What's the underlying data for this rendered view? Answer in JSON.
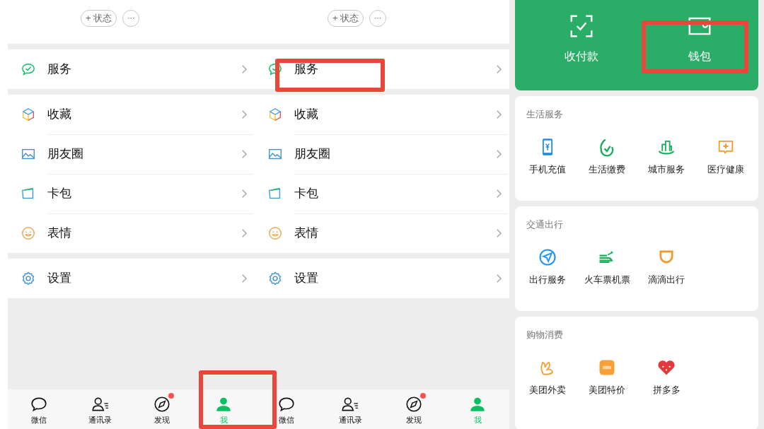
{
  "phones": [
    {
      "status_button": "+ 状态",
      "more_button": "···",
      "groups": [
        [
          {
            "kind": "services",
            "label": "服务"
          }
        ],
        [
          {
            "kind": "favorites",
            "label": "收藏"
          },
          {
            "kind": "moments",
            "label": "朋友圈"
          },
          {
            "kind": "cards",
            "label": "卡包"
          },
          {
            "kind": "stickers",
            "label": "表情"
          }
        ],
        [
          {
            "kind": "settings",
            "label": "设置"
          }
        ]
      ],
      "tabs": [
        {
          "kind": "chats",
          "label": "微信",
          "selected": false,
          "dot": false
        },
        {
          "kind": "contacts",
          "label": "通讯录",
          "selected": false,
          "dot": false
        },
        {
          "kind": "discover",
          "label": "发现",
          "selected": false,
          "dot": true
        },
        {
          "kind": "me",
          "label": "我",
          "selected": true,
          "dot": false
        }
      ]
    },
    {
      "status_button": "+ 状态",
      "more_button": "···",
      "groups": [
        [
          {
            "kind": "services",
            "label": "服务"
          }
        ],
        [
          {
            "kind": "favorites",
            "label": "收藏"
          },
          {
            "kind": "moments",
            "label": "朋友圈"
          },
          {
            "kind": "cards",
            "label": "卡包"
          },
          {
            "kind": "stickers",
            "label": "表情"
          }
        ],
        [
          {
            "kind": "settings",
            "label": "设置"
          }
        ]
      ],
      "tabs": [
        {
          "kind": "chats",
          "label": "微信",
          "selected": false,
          "dot": false
        },
        {
          "kind": "contacts",
          "label": "通讯录",
          "selected": false,
          "dot": false
        },
        {
          "kind": "discover",
          "label": "发现",
          "selected": false,
          "dot": true
        },
        {
          "kind": "me",
          "label": "我",
          "selected": true,
          "dot": false
        }
      ]
    }
  ],
  "services": {
    "pay_actions": [
      {
        "kind": "scan",
        "label": "收付款"
      },
      {
        "kind": "wallet",
        "label": "钱包"
      }
    ],
    "sections": [
      {
        "title": "生活服务",
        "items": [
          {
            "kind": "phone",
            "label": "手机充值"
          },
          {
            "kind": "bill",
            "label": "生活缴费"
          },
          {
            "kind": "city",
            "label": "城市服务"
          },
          {
            "kind": "health",
            "label": "医疗健康"
          }
        ]
      },
      {
        "title": "交通出行",
        "items": [
          {
            "kind": "travel",
            "label": "出行服务"
          },
          {
            "kind": "train",
            "label": "火车票机票"
          },
          {
            "kind": "ride",
            "label": "滴滴出行"
          }
        ]
      },
      {
        "title": "购物消费",
        "items": [
          {
            "kind": "delivery",
            "label": "美团外卖"
          },
          {
            "kind": "deals",
            "label": "美团特价"
          },
          {
            "kind": "group",
            "label": "拼多多"
          }
        ]
      }
    ]
  }
}
